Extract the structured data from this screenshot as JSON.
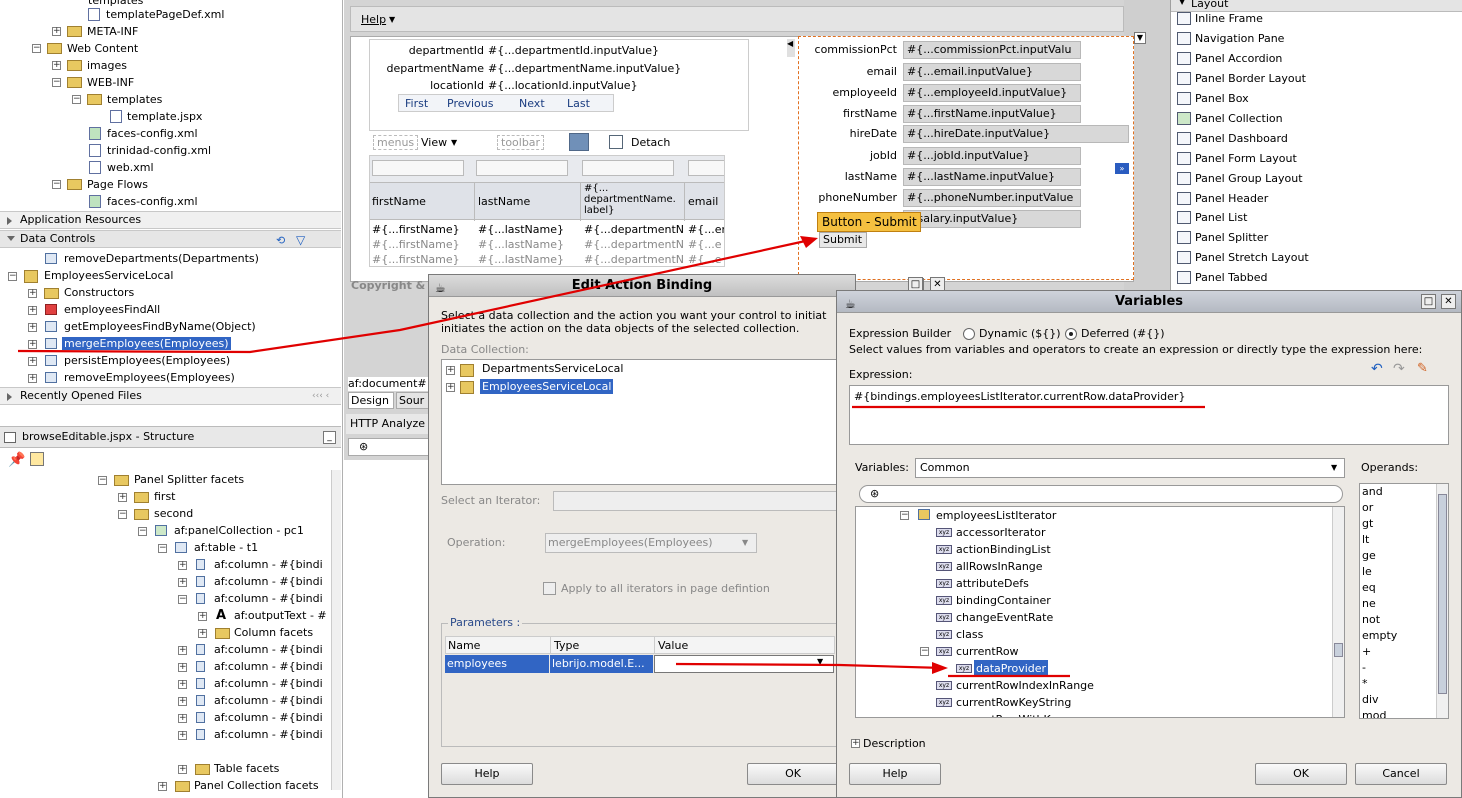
{
  "left_tree": {
    "items": [
      "templates",
      "templatePageDef.xml",
      "META-INF",
      "Web Content",
      "images",
      "WEB-INF",
      "templates",
      "template.jspx",
      "faces-config.xml",
      "trinidad-config.xml",
      "web.xml",
      "Page Flows",
      "faces-config.xml"
    ],
    "app_resources": "Application Resources",
    "data_controls": "Data Controls",
    "dc_items": [
      "removeDepartments(Departments)",
      "EmployeesServiceLocal",
      "Constructors",
      "employeesFindAll",
      "getEmployeesFindByName(Object)",
      "mergeEmployees(Employees)",
      "persistEmployees(Employees)",
      "removeEmployees(Employees)"
    ],
    "recent": "Recently Opened Files",
    "scroll_arrows": "‹‹‹ ‹"
  },
  "structure": {
    "title": "browseEditable.jspx - Structure",
    "items": [
      "Panel Splitter facets",
      "first",
      "second",
      "af:panelCollection - pc1",
      "af:table - t1",
      "af:column - #{bindi",
      "af:column - #{bindi",
      "af:column - #{bindi",
      "af:outputText - #",
      "Column facets",
      "af:column - #{bindi",
      "af:column - #{bindi",
      "af:column - #{bindi",
      "af:column - #{bindi",
      "af:column - #{bindi",
      "af:column - #{bindi",
      "Table facets",
      "Panel Collection facets"
    ]
  },
  "editor": {
    "menu_help": "Help",
    "form_rows": [
      {
        "label": "departmentId",
        "value": "#{...departmentId.inputValue}"
      },
      {
        "label": "departmentName",
        "value": "#{...departmentName.inputValue}"
      },
      {
        "label": "locationId",
        "value": "#{...locationId.inputValue}"
      }
    ],
    "nav_buttons": [
      "First",
      "Previous",
      "Next",
      "Last"
    ],
    "menus": "menus",
    "view": "View",
    "toolbar": "toolbar",
    "detach": "Detach",
    "table_headers": [
      "firstName",
      "lastName",
      "#{...departmentName.label}",
      "email"
    ],
    "table_header_dept_parts": [
      "#{...",
      "departmentName.",
      "label}"
    ],
    "table_rows": [
      [
        "#{...firstName}",
        "#{...lastName}",
        "#{...departmentN",
        "#{...er"
      ],
      [
        "#{...firstName}",
        "#{...lastName}",
        "#{...departmentN",
        "#{...e"
      ],
      [
        "#{...firstName}",
        "#{...lastName}",
        "#{...departmentN",
        "#{...e"
      ]
    ],
    "right_form": [
      {
        "label": "commissionPct",
        "value": "#{...commissionPct.inputValu"
      },
      {
        "label": "email",
        "value": "#{...email.inputValue}"
      },
      {
        "label": "employeeId",
        "value": "#{...employeeId.inputValue}"
      },
      {
        "label": "firstName",
        "value": "#{...firstName.inputValue}"
      },
      {
        "label": "hireDate",
        "value": "#{...hireDate.inputValue}"
      },
      {
        "label": "jobId",
        "value": "#{...jobId.inputValue}"
      },
      {
        "label": "lastName",
        "value": "#{...lastName.inputValue}"
      },
      {
        "label": "phoneNumber",
        "value": "#{...phoneNumber.inputValue"
      },
      {
        "label": "salary",
        "value": "...salary.inputValue}"
      }
    ],
    "tooltip": "Button - Submit",
    "submit": "Submit",
    "copyright": "Copyright &",
    "doc_tab": "af:document#",
    "design_tab": "Design",
    "source_tab": "Sour",
    "http_analyzer": "HTTP Analyze"
  },
  "palette": {
    "header": "Layout",
    "items": [
      "Inline Frame",
      "Navigation Pane",
      "Panel Accordion",
      "Panel Border Layout",
      "Panel Box",
      "Panel Collection",
      "Panel Dashboard",
      "Panel Form Layout",
      "Panel Group Layout",
      "Panel Header",
      "Panel List",
      "Panel Splitter",
      "Panel Stretch Layout",
      "Panel Tabbed"
    ]
  },
  "edit_binding": {
    "title": "Edit Action Binding",
    "intro": "Select a data collection and the action you want your control to initiat initiates the action on the data objects of the selected collection.",
    "intro_line1": "Select a data collection and the action you want your control to initiat",
    "intro_line2": "initiates the action on the data objects of the selected collection.",
    "data_collection_label": "Data Collection:",
    "collections": [
      "DepartmentsServiceLocal",
      "EmployeesServiceLocal"
    ],
    "iterator_label": "Select an Iterator:",
    "operation_label": "Operation:",
    "operation_value": "mergeEmployees(Employees)",
    "apply_all": "Apply to all iterators in page defintion",
    "parameters_label": "Parameters :",
    "param_headers": [
      "Name",
      "Type",
      "Value"
    ],
    "param_row": {
      "name": "employees",
      "type": "lebrijo.model.E...",
      "value": ""
    },
    "help": "Help",
    "ok": "OK"
  },
  "variables": {
    "title": "Variables",
    "builder_label": "Expression Builder",
    "dynamic": "Dynamic (${})",
    "deferred": "Deferred (#{})",
    "instructions": "Select values from variables and operators to create an expression or directly type the expression here:",
    "expression_label": "Expression:",
    "expression": "#{bindings.employeesListIterator.currentRow.dataProvider}",
    "variables_label": "Variables:",
    "variables_select": "Common",
    "operands_label": "Operands:",
    "tree": [
      "employeesListIterator",
      "accessorIterator",
      "actionBindingList",
      "allRowsInRange",
      "attributeDefs",
      "bindingContainer",
      "changeEventRate",
      "class",
      "currentRow",
      "dataProvider",
      "currentRowIndexInRange",
      "currentRowKeyString",
      "currentRowWithKey"
    ],
    "operands": [
      "and",
      "or",
      "gt",
      "lt",
      "ge",
      "le",
      "eq",
      "ne",
      "not",
      "empty",
      "+",
      "-",
      "*",
      "div",
      "mod"
    ],
    "description": "Description",
    "help": "Help",
    "ok": "OK",
    "cancel": "Cancel"
  },
  "colors": {
    "selection": "#3165c4",
    "annotation": "#e00000",
    "tooltip": "#f5c040"
  }
}
